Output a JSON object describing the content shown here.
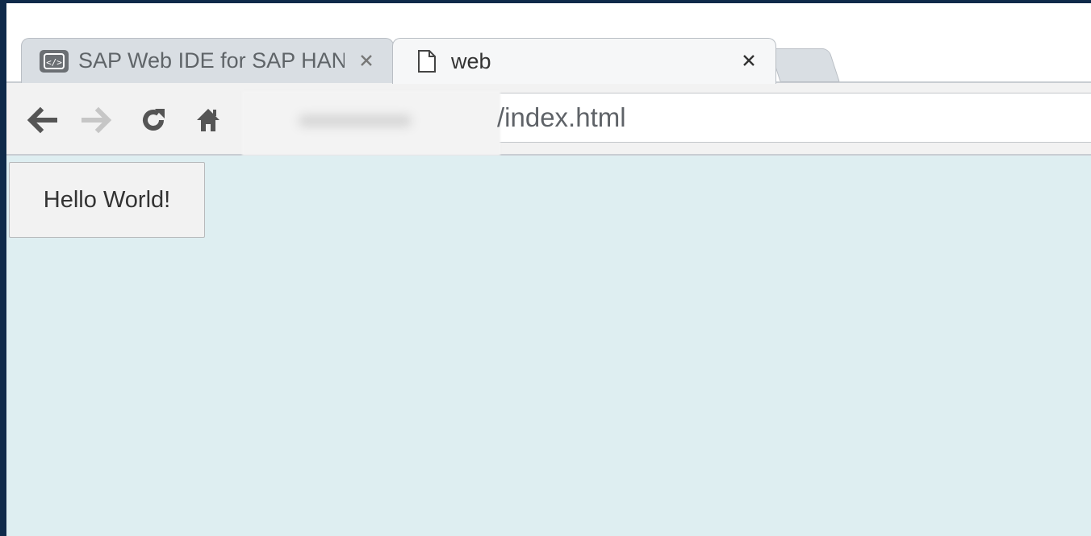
{
  "browser": {
    "tabs": [
      {
        "title": "SAP Web IDE for SAP HAN",
        "active": false,
        "icon": "app-code-icon"
      },
      {
        "title": "web",
        "active": true,
        "icon": "document-icon"
      }
    ],
    "close_glyph": "×",
    "address": {
      "url_visible": "/index.html"
    }
  },
  "page": {
    "button_label": "Hello World!",
    "background": "#deeef1"
  }
}
